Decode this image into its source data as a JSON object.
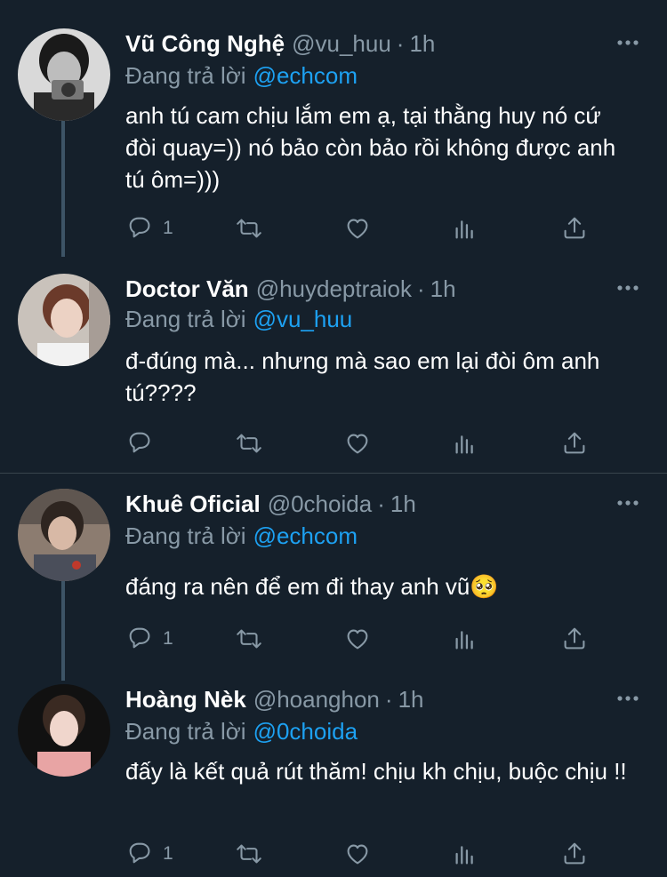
{
  "colors": {
    "background": "#15202b",
    "text": "#ffffff",
    "muted": "#8899a6",
    "link": "#1da1f2",
    "divider": "#38444d"
  },
  "icons": {
    "reply": "comment-icon",
    "retweet": "retweet-icon",
    "like": "heart-icon",
    "stats": "stats-icon",
    "share": "share-icon",
    "more": "more-dots-icon"
  },
  "tweets": [
    {
      "name": "Vũ Công Nghệ",
      "handle": "@vu_huu",
      "dot": "·",
      "time": "1h",
      "reply_prefix": "Đang trả lời",
      "reply_to": "@echcom",
      "text": "anh tú cam chịu lắm em ạ, tại thằng huy nó cứ đòi quay=)) nó bảo còn bảo rồi không được anh tú ôm=)))",
      "reply_count": "1"
    },
    {
      "name": "Doctor Văn",
      "handle": "@huydeptraiok",
      "dot": "·",
      "time": "1h",
      "reply_prefix": "Đang trả lời",
      "reply_to": "@vu_huu",
      "text": "đ-đúng mà... nhưng mà sao em lại đòi ôm anh tú????",
      "reply_count": ""
    },
    {
      "name": "Khuê Oficial",
      "handle": "@0choida",
      "dot": "·",
      "time": "1h",
      "reply_prefix": "Đang trả lời",
      "reply_to": "@echcom",
      "text": "đáng ra nên để em đi thay anh vũ🥺",
      "reply_count": "1"
    },
    {
      "name": "Hoàng Nèk",
      "handle": "@hoanghon",
      "dot": "·",
      "time": "1h",
      "reply_prefix": "Đang trả lời",
      "reply_to": "@0choida",
      "text": "đấy là kết quả rút thăm! chịu kh chịu, buộc chịu !!",
      "reply_count": "1"
    }
  ]
}
